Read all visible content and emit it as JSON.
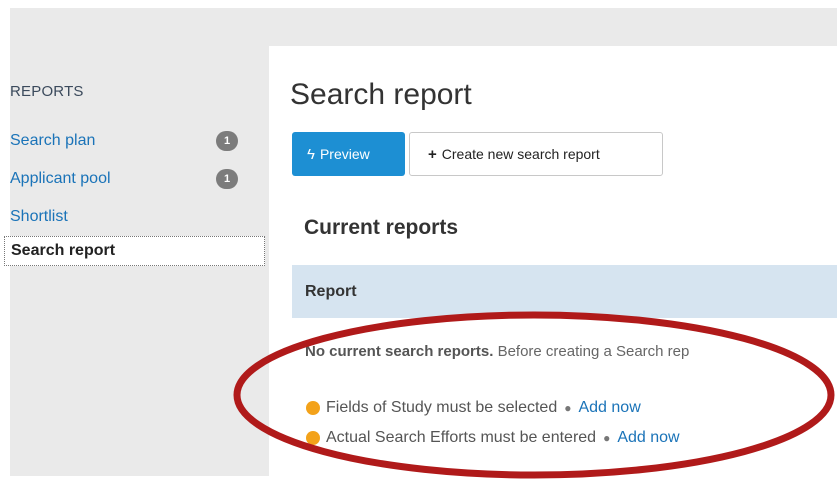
{
  "sidebar": {
    "heading": "REPORTS",
    "items": [
      {
        "label": "Search plan",
        "badge": "1"
      },
      {
        "label": "Applicant pool",
        "badge": "1"
      },
      {
        "label": "Shortlist",
        "badge": ""
      },
      {
        "label": "Search report",
        "badge": ""
      }
    ]
  },
  "main": {
    "title": "Search report",
    "preview_button": "Preview",
    "create_button": "Create new search report",
    "section_title": "Current reports",
    "table_header": "Report",
    "empty_bold": "No current search reports.",
    "empty_rest": " Before creating a Search rep",
    "requirements": [
      {
        "text": "Fields of Study must be selected",
        "link": "Add now"
      },
      {
        "text": "Actual Search Efforts must be entered",
        "link": "Add now"
      }
    ]
  },
  "colors": {
    "accent": "#1d8fd3",
    "status_dot": "#f3a21a",
    "annotation": "#b01a1a"
  },
  "icons": [
    "bolt-icon",
    "plus-icon",
    "status-dot-icon"
  ]
}
